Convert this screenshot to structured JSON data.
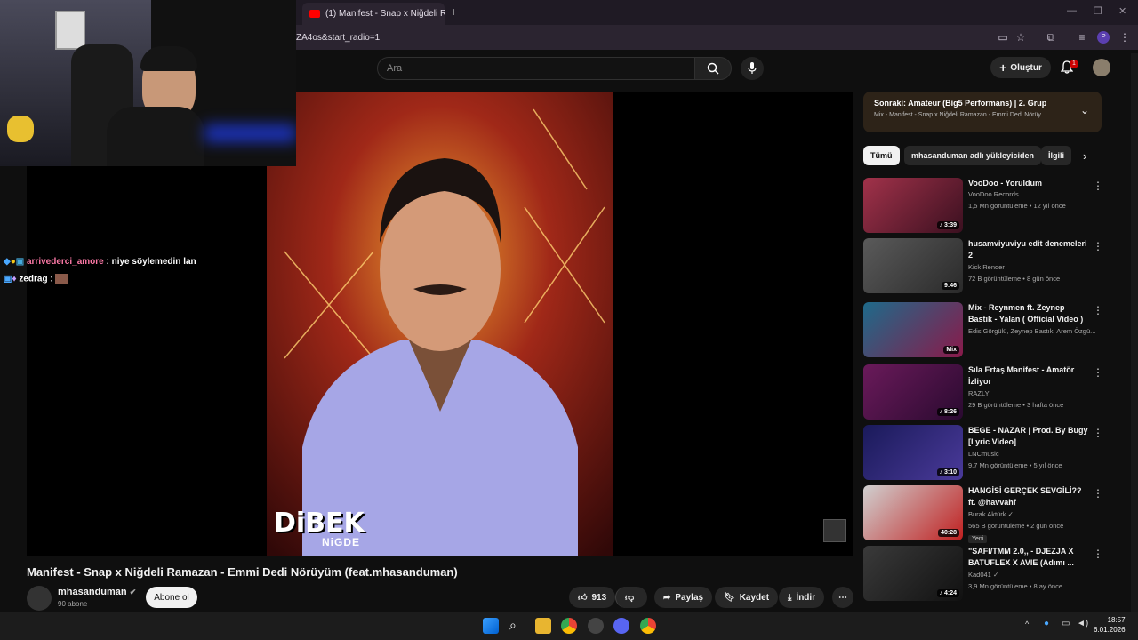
{
  "browser": {
    "tab_title": "(1) Manifest - Snap x Niğdeli R...",
    "url": "ZA4os&start_radio=1",
    "profile_initial": "P"
  },
  "header": {
    "search_placeholder": "Ara",
    "create_label": "Oluştur",
    "notif_count": "1"
  },
  "chat": [
    {
      "user": "arrivederci_amore",
      "msg": " : niye söylemedin lan"
    },
    {
      "user": "zedrag",
      "msg": " : "
    }
  ],
  "cover": {
    "logo_main": "DiBEK",
    "logo_sub": "NiGDE"
  },
  "video": {
    "title": "Manifest - Snap x Niğdeli Ramazan - Emmi Dedi Nörüyüm (feat.mhasanduman)",
    "channel": "mhasanduman",
    "subs": "90 abone",
    "subscribe": "Abone ol",
    "likes": "913",
    "share": "Paylaş",
    "save": "Kaydet",
    "download": "İndir"
  },
  "next": {
    "title": "Sonraki: Amateur (Big5 Performans) | 2. Grup",
    "subtitle": "Mix - Manifest - Snap x Niğdeli Ramazan - Emmi Dedi Nörüy..."
  },
  "chips": [
    "Tümü",
    "mhasanduman adlı yükleyiciden",
    "İlgili"
  ],
  "recs": [
    {
      "title": "VooDoo - Yoruldum",
      "channel": "VooDoo Records",
      "meta": "1,5 Mn görüntüleme • 12 yıl önce",
      "dur": "♪ 3:39",
      "c1": "#a1324a",
      "c2": "#3b1020"
    },
    {
      "title": "husamviyuviyu edit denemeleri 2",
      "channel": "Kick Render",
      "meta": "72 B görüntüleme • 8 gün önce",
      "dur": "9:46",
      "c1": "#5a5a5a",
      "c2": "#2a2a2a"
    },
    {
      "title": "Mix - Reynmen ft. Zeynep Bastık - Yalan ( Official Video )",
      "channel": "Edis Görgülü, Zeynep Bastık, Arem Özgü...",
      "meta": "",
      "dur": "Mix",
      "c1": "#1e6a8a",
      "c2": "#8a1a4a"
    },
    {
      "title": "Sıla Ertaş Manifest - Amatör İzliyor",
      "channel": "RAZLY",
      "meta": "29 B görüntüleme • 3 hafta önce",
      "dur": "♪ 8:26",
      "c1": "#6a1a5a",
      "c2": "#2a0a30"
    },
    {
      "title": "BEGE - NAZAR | Prod. By Bugy [Lyric Video]",
      "channel": "LNCmusic",
      "meta": "9,7 Mn görüntüleme • 5 yıl önce",
      "dur": "♪ 3:10",
      "c1": "#1a1a5a",
      "c2": "#4a3a9a"
    },
    {
      "title": "HANGİSİ GERÇEK SEVGİLİ?? ft. @havvahf",
      "channel": "Burak Aktürk ✓",
      "meta": "565 B görüntüleme • 2 gün önce",
      "dur": "40:28",
      "c1": "#d0d0d0",
      "c2": "#c02020",
      "badge": "Yeni"
    },
    {
      "title": "\"SAFI/TMM 2.0,, - DJEZJA X BATUFLEX X AVIE (Adımı ...",
      "channel": "Kad041 ✓",
      "meta": "3,9 Mn görüntüleme • 8 ay önce",
      "dur": "♪ 4:24",
      "c1": "#3a3a3a",
      "c2": "#111111"
    }
  ],
  "taskbar": {
    "time": "18:57",
    "date": "6.01.2026"
  }
}
